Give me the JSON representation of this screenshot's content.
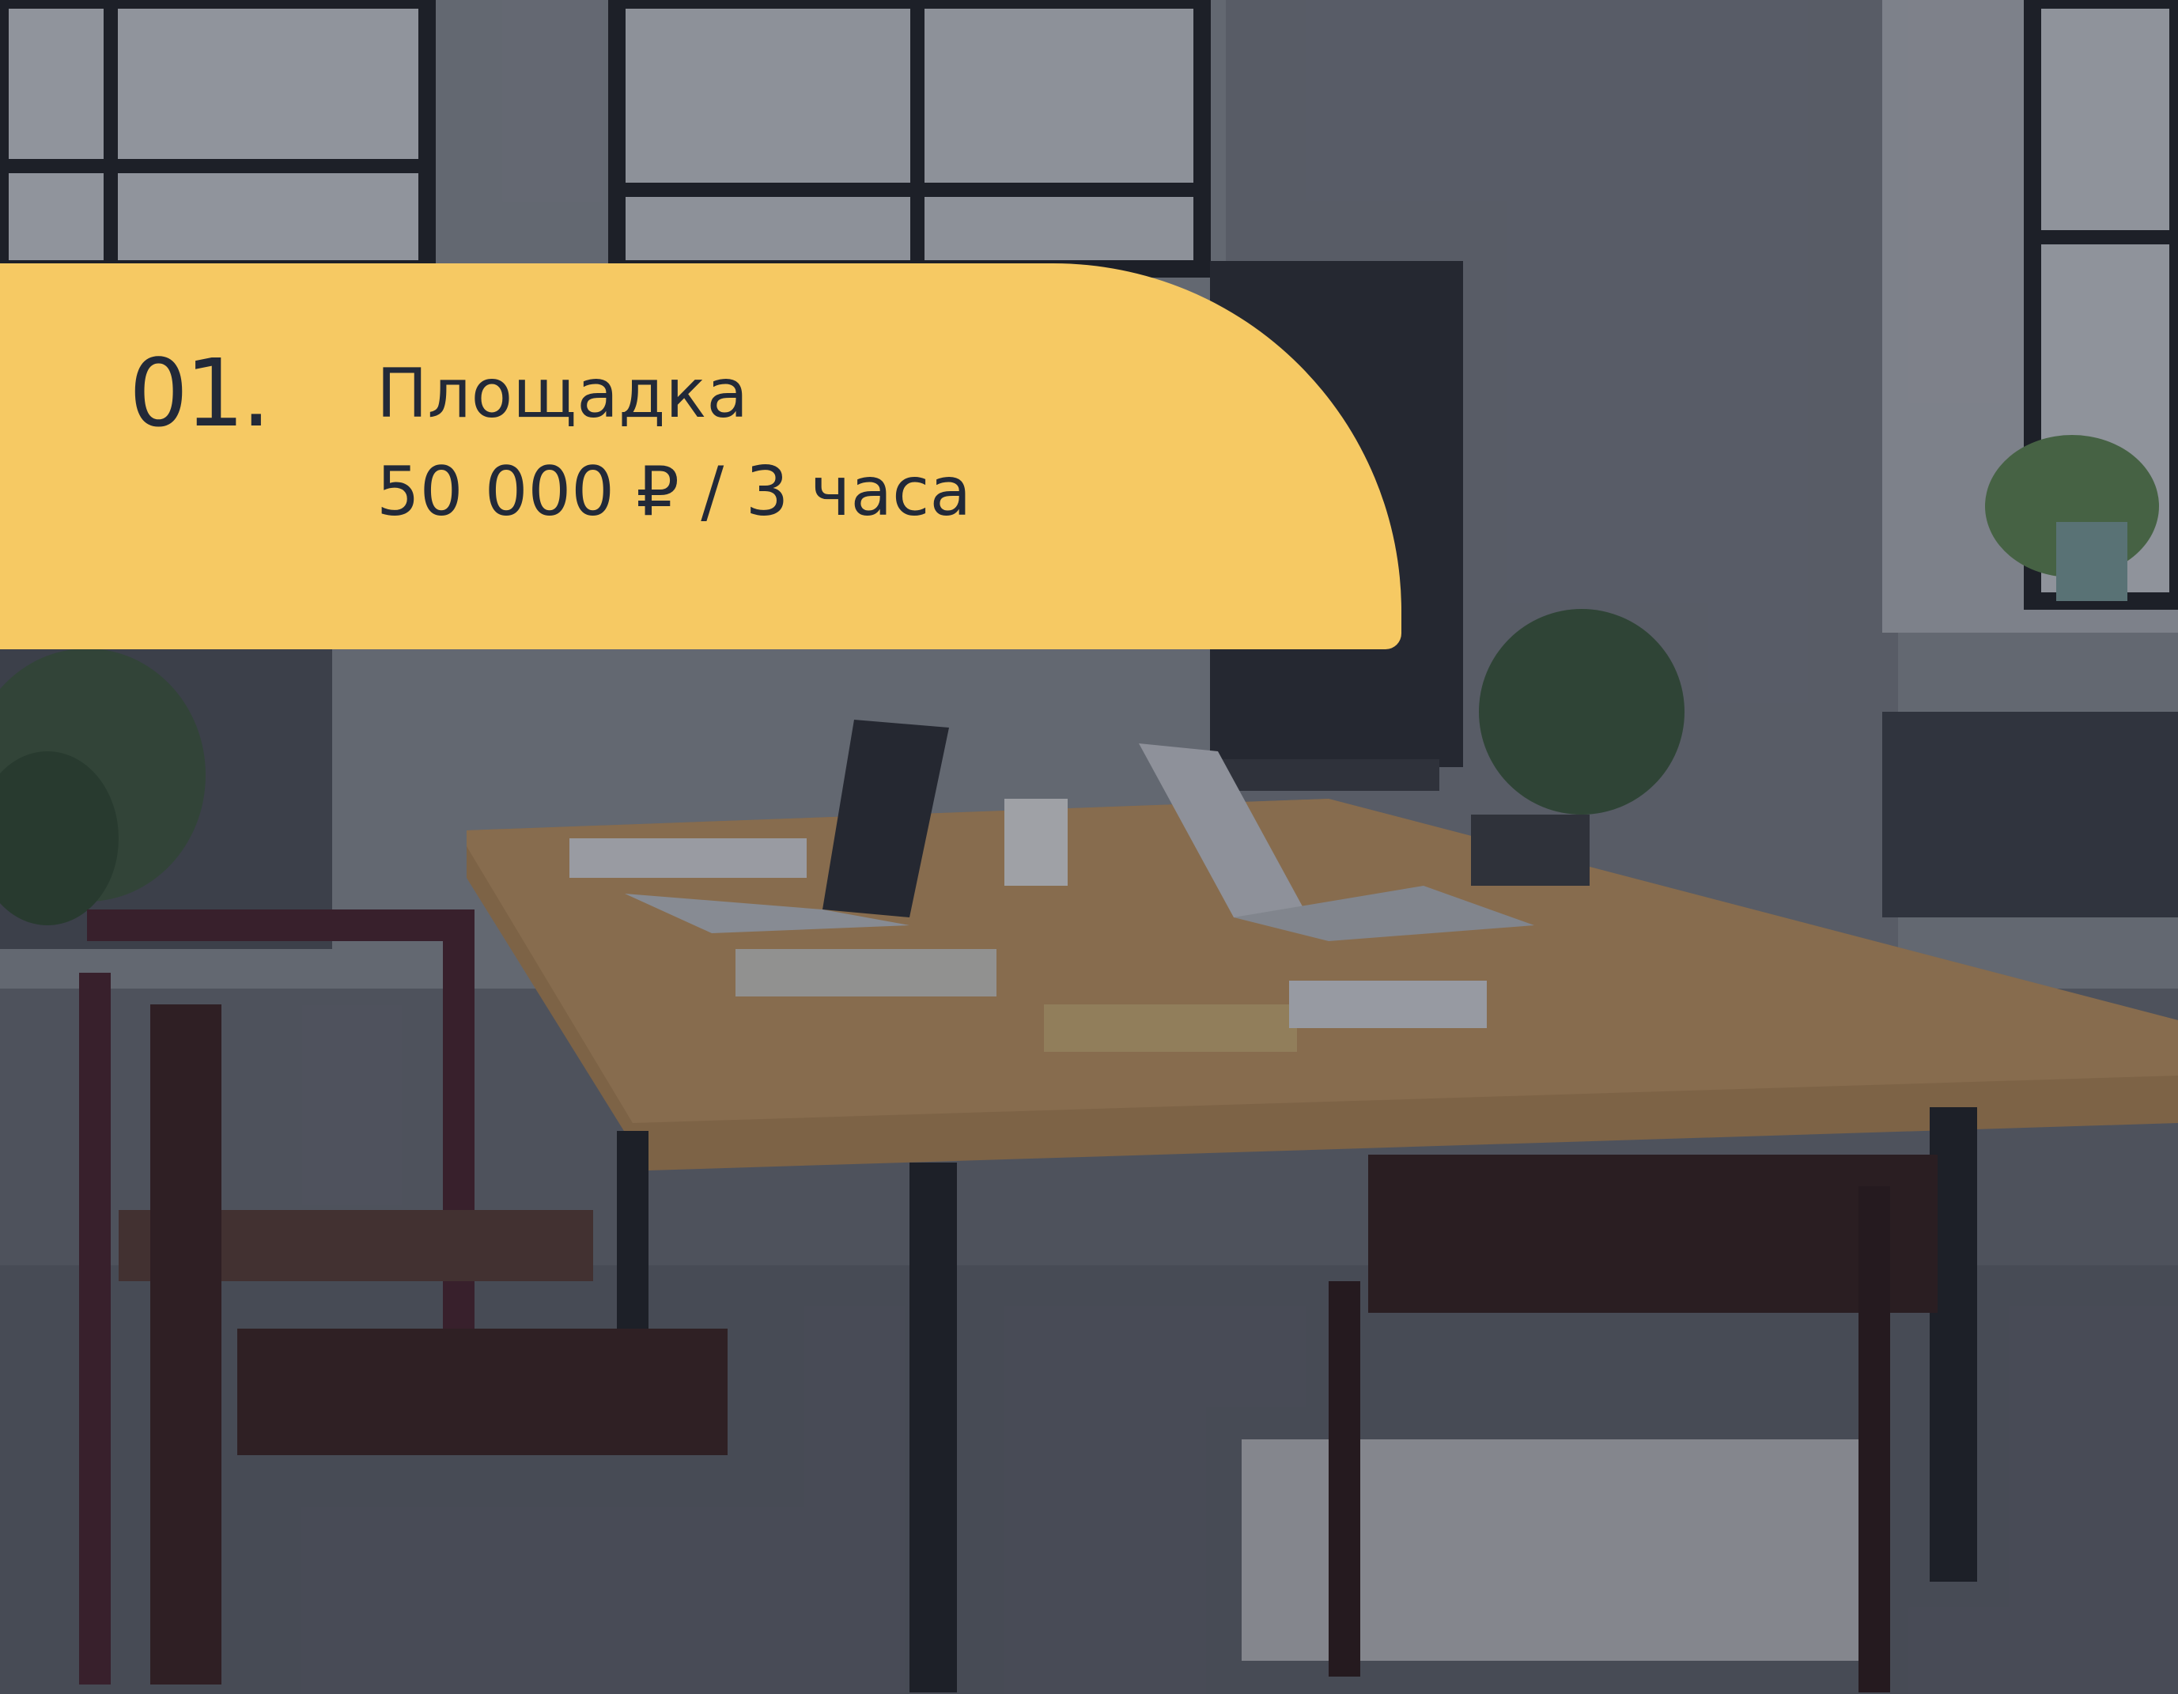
{
  "slide": {
    "number": "01.",
    "title": "Площадка",
    "price": "50 000 ₽ / 3 часа"
  },
  "colors": {
    "banner": "#f6c963",
    "text": "#222938",
    "overlay": "#1e2130"
  },
  "background": {
    "subject": "conference-room-photo"
  }
}
